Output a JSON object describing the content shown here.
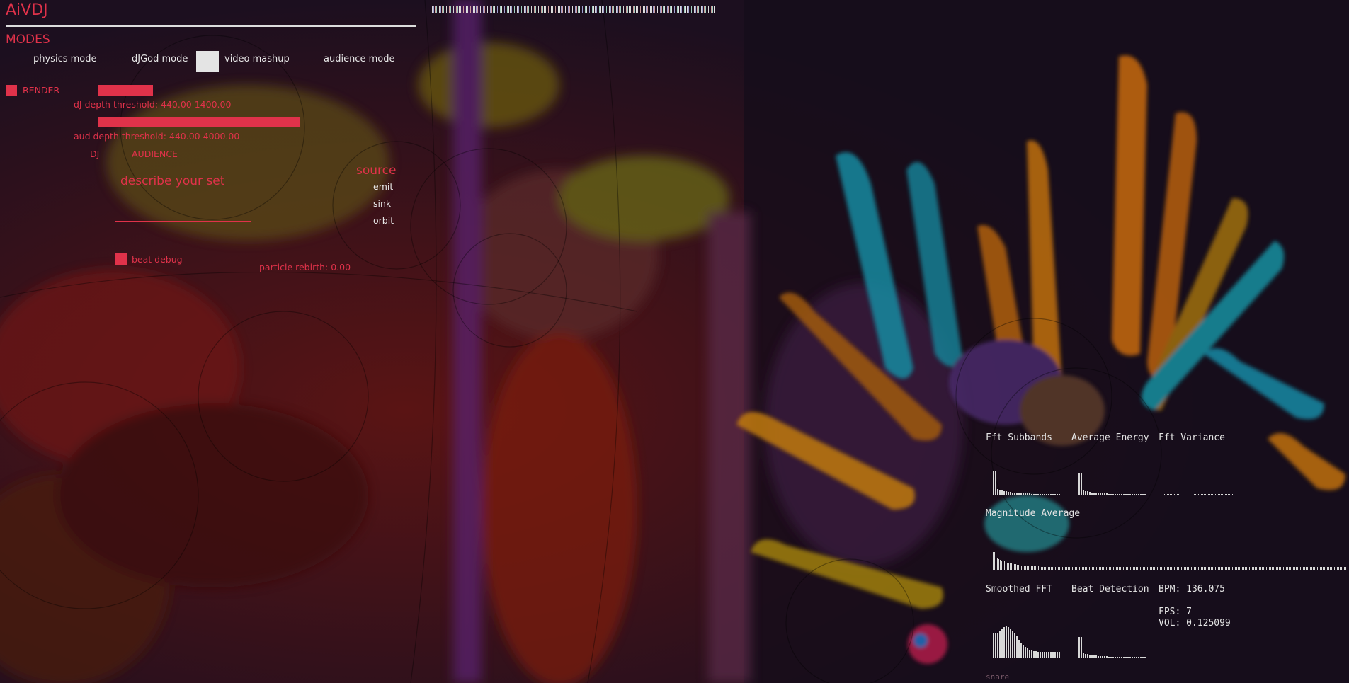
{
  "app": {
    "title": "AiVDJ"
  },
  "modes": {
    "heading": "MODES",
    "buttons": [
      {
        "label": "physics mode"
      },
      {
        "label": "dJGod mode"
      },
      {
        "label": "video mashup"
      },
      {
        "label": "audience mode"
      }
    ]
  },
  "controls": {
    "render_label": "RENDER",
    "dj_threshold_label": "dJ depth threshold: 440.00 1400.00",
    "aud_threshold_label": "aud depth threshold: 440.00 4000.00",
    "dj_label": "DJ",
    "audience_label": "AUDIENCE",
    "describe_label": "describe your set",
    "source_heading": "source",
    "source_options": [
      "emit",
      "sink",
      "orbit"
    ],
    "beat_debug_label": "beat debug",
    "particle_rebirth_label": "particle rebirth: 0.00",
    "dj_threshold_values": [
      440.0,
      1400.0
    ],
    "aud_threshold_values": [
      440.0,
      4000.0
    ]
  },
  "audio_viz": {
    "fft_subbands": "Fft Subbands",
    "average_energy": "Average Energy",
    "fft_variance": "Fft Variance",
    "magnitude_average": "Magnitude Average",
    "smoothed_fft": "Smoothed FFT",
    "beat_detection": "Beat Detection",
    "bpm": "BPM: 136.075",
    "fps": "FPS: 7",
    "vol": "VOL: 0.125099",
    "snare_label": "snare"
  },
  "colors": {
    "accent": "#e0324a",
    "text": "#e8e8e8"
  }
}
